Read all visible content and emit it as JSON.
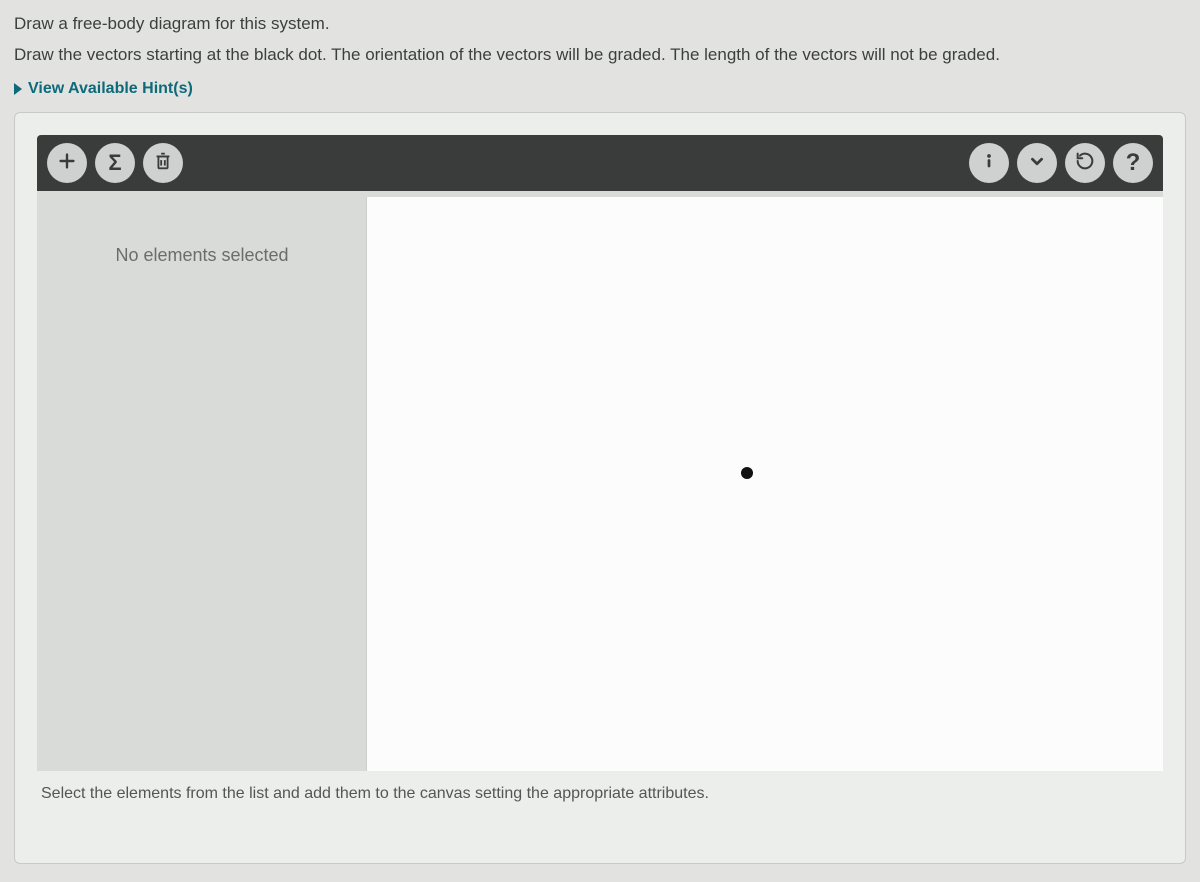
{
  "instructions": {
    "line1": "Draw a free-body diagram for this system.",
    "line2": "Draw the vectors starting at the black dot. The orientation of the vectors will be graded. The length of the vectors will not be graded."
  },
  "hints": {
    "toggle_label": "View Available Hint(s)"
  },
  "toolbar": {
    "left": {
      "add": "add-vector",
      "sigma": "sum-vectors",
      "trash": "delete"
    },
    "right": {
      "info": "info",
      "dropdown": "dropdown",
      "reset": "reset",
      "help": "help"
    }
  },
  "side_panel": {
    "status": "No elements selected"
  },
  "canvas": {
    "dot_label": "origin-dot"
  },
  "footer": {
    "hint_text": "Select the elements from the list and add them to the canvas setting the appropriate attributes."
  },
  "icon_glyphs": {
    "sigma": "Σ",
    "help": "?"
  }
}
